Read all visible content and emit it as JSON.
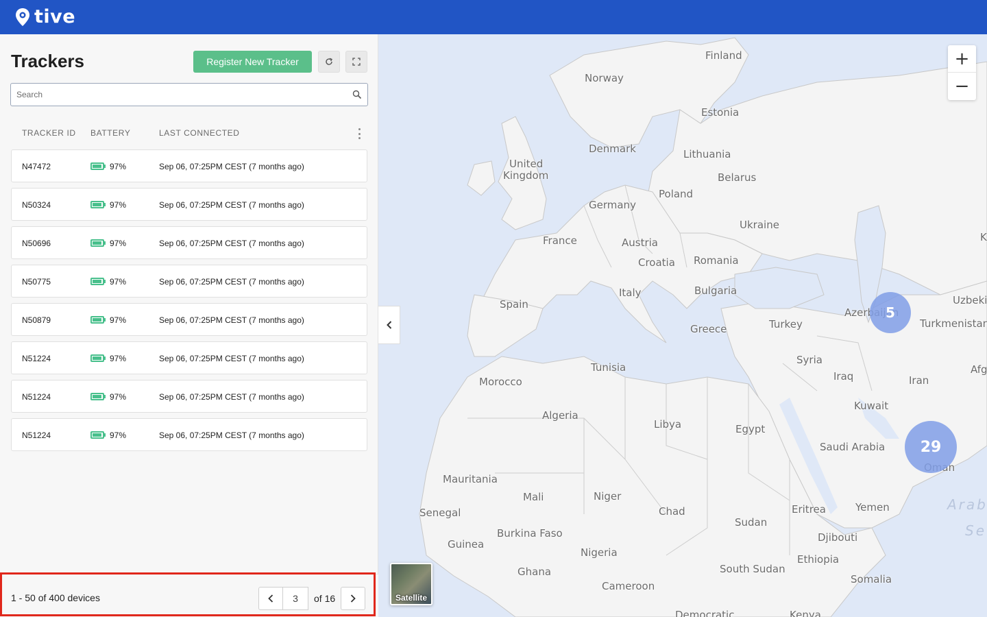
{
  "header": {
    "brand": "tive"
  },
  "panel": {
    "title": "Trackers",
    "register_label": "Register New Tracker",
    "search_placeholder": "Search",
    "columns": {
      "tracker_id": "TRACKER ID",
      "battery": "BATTERY",
      "last_connected": "LAST CONNECTED"
    },
    "rows": [
      {
        "id": "N47472",
        "battery": "97%",
        "last": "Sep 06, 07:25PM CEST (7 months ago)"
      },
      {
        "id": "N50324",
        "battery": "97%",
        "last": "Sep 06, 07:25PM CEST (7 months ago)"
      },
      {
        "id": "N50696",
        "battery": "97%",
        "last": "Sep 06, 07:25PM CEST (7 months ago)"
      },
      {
        "id": "N50775",
        "battery": "97%",
        "last": "Sep 06, 07:25PM CEST (7 months ago)"
      },
      {
        "id": "N50879",
        "battery": "97%",
        "last": "Sep 06, 07:25PM CEST (7 months ago)"
      },
      {
        "id": "N51224",
        "battery": "97%",
        "last": "Sep 06, 07:25PM CEST (7 months ago)"
      },
      {
        "id": "N51224",
        "battery": "97%",
        "last": "Sep 06, 07:25PM CEST (7 months ago)"
      },
      {
        "id": "N51224",
        "battery": "97%",
        "last": "Sep 06, 07:25PM CEST (7 months ago)"
      }
    ],
    "footer": {
      "count": "1 - 50 of 400 devices",
      "page": "3",
      "of_pages": "of 16"
    }
  },
  "map": {
    "zoom_in": "+",
    "zoom_out": "−",
    "satellite_label": "Satellite",
    "clusters": {
      "c1": "5",
      "c2": "29"
    },
    "labels": {
      "finland": "Finland",
      "norway": "Norway",
      "estonia": "Estonia",
      "denmark": "Denmark",
      "lithuania": "Lithuania",
      "uk1": "United",
      "uk2": "Kingdom",
      "belarus": "Belarus",
      "poland": "Poland",
      "germany": "Germany",
      "ukraine": "Ukraine",
      "france": "France",
      "austria": "Austria",
      "croatia": "Croatia",
      "romania": "Romania",
      "italy": "Italy",
      "bulgaria": "Bulgaria",
      "spain": "Spain",
      "greece": "Greece",
      "turkey": "Turkey",
      "azerbaijan": "Azerbaijan",
      "turkmenistan": "Turkmenistan",
      "uzbek": "Uzbeki",
      "syria": "Syria",
      "iraq": "Iraq",
      "iran": "Iran",
      "afg": "Afg",
      "tunisia": "Tunisia",
      "morocco": "Morocco",
      "kuwait": "Kuwait",
      "algeria": "Algeria",
      "libya": "Libya",
      "egypt": "Egypt",
      "saudi": "Saudi Arabia",
      "oman": "Oman",
      "mauritania": "Mauritania",
      "mali": "Mali",
      "niger": "Niger",
      "chad": "Chad",
      "eritrea": "Eritrea",
      "yemen": "Yemen",
      "senegal": "Senegal",
      "sudan": "Sudan",
      "burkina": "Burkina Faso",
      "djibouti": "Djibouti",
      "guinea": "Guinea",
      "nigeria": "Nigeria",
      "ethiopia": "Ethiopia",
      "ghana": "Ghana",
      "south_sudan": "South Sudan",
      "somalia": "Somalia",
      "cameroon": "Cameroon",
      "drc": "Democratic",
      "kenya": "Kenya",
      "k": "K",
      "arab1": "Arab",
      "arab2": "Se"
    }
  },
  "colors": {
    "header": "#2155c5",
    "accent_green": "#5bbf8a",
    "battery": "#48c08c",
    "highlight": "#e0271b",
    "cluster": "#809ee6"
  }
}
